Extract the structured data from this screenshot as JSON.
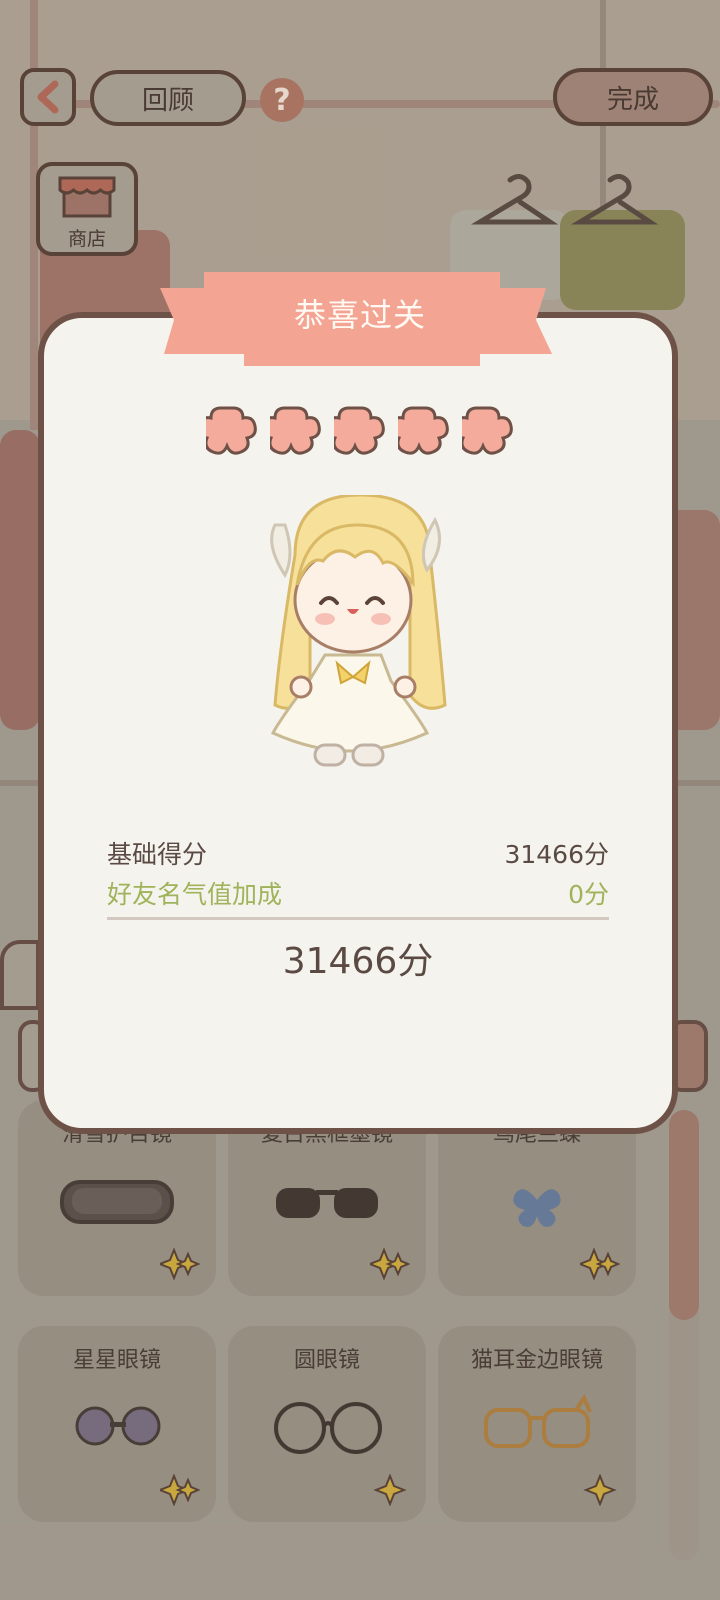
{
  "header": {
    "back_icon": "chevron-left-icon",
    "review_label": "回顾",
    "help_icon": "question-mark-icon",
    "help_glyph": "?",
    "done_label": "完成"
  },
  "shop": {
    "icon": "shop-icon",
    "label": "商店"
  },
  "modal": {
    "title": "恭喜过关",
    "stars_count": 5,
    "base_score_label": "基础得分",
    "base_score_value": "31466分",
    "bonus_label": "好友名气值加成",
    "bonus_value": "0分",
    "total_score": "31466分"
  },
  "items": [
    {
      "name": "滑雪护目镜",
      "icon": "ski-goggles-icon"
    },
    {
      "name": "复古黑框墨镜",
      "icon": "retro-sunglasses-icon"
    },
    {
      "name": "鸢尾兰蝶",
      "icon": "butterfly-icon"
    },
    {
      "name": "星星眼镜",
      "icon": "star-glasses-icon"
    },
    {
      "name": "圆眼镜",
      "icon": "round-glasses-icon"
    },
    {
      "name": "猫耳金边眼镜",
      "icon": "cat-ear-glasses-icon"
    }
  ],
  "colors": {
    "ribbon": "#f4a492",
    "star": "#f4ab9b",
    "bonus_text": "#9fb35a",
    "modal_bg": "#f5f3ed",
    "border": "#6e5248"
  }
}
